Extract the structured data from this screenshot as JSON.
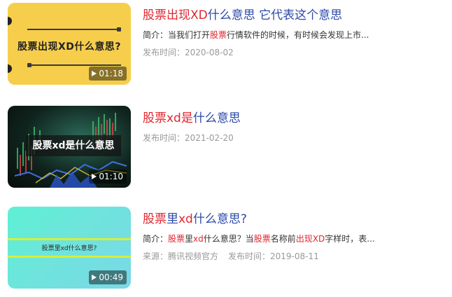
{
  "items": [
    {
      "title_pre": "股票出现XD",
      "title_post": "什么意思 它代表这个意思",
      "desc_prefix": "简介：当我们打开",
      "desc_hl": "股票",
      "desc_suffix": "行情软件的时候，有时候会发现上市...",
      "date": "发布时间：2020-08-02",
      "thumb_caption": "股票出现XD什么意思?",
      "duration": "01:18"
    },
    {
      "title_pre": "股票xd是",
      "title_post": "什么意思",
      "date": "发布时间：2021-02-20",
      "thumb_caption": "股票xd是什么意思",
      "duration": "01:10"
    },
    {
      "title_a": "股票",
      "title_b": "里",
      "title_c": "xd",
      "title_d": "什么意思?",
      "desc_1": "简介：",
      "desc_2": "股票",
      "desc_3": "里",
      "desc_4": "xd",
      "desc_5": "什么意思？当",
      "desc_6": "股票",
      "desc_7": "名称前",
      "desc_8": "出现XD",
      "desc_9": "字样时，表...",
      "source": "来源：腾讯视频官方",
      "date": "发布时间：2019-08-11",
      "thumb_caption": "股票里xd什么意思?",
      "duration": "00:49"
    }
  ],
  "colors": {
    "title": "#2b4aa8",
    "highlight": "#e0262e",
    "meta": "#999999",
    "thumb1_bg": "#f6ce4c",
    "thumb3_bg": "#5ef0d4"
  },
  "icons": [
    "play-icon"
  ]
}
